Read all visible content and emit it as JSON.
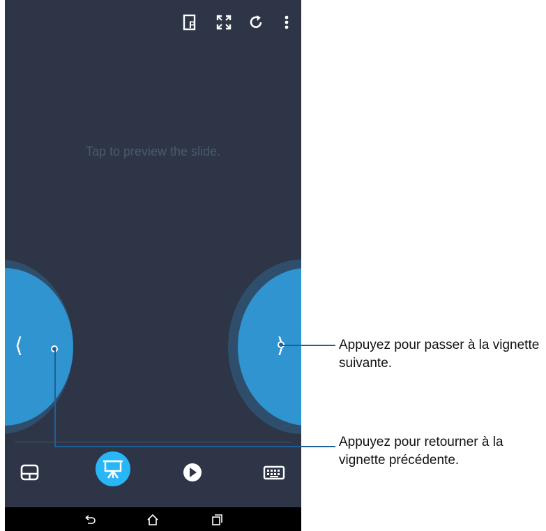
{
  "preview": {
    "hint": "Tap to preview the slide."
  },
  "nav": {
    "prev_glyph": "⟨",
    "next_glyph": "⟩"
  },
  "topbar": {
    "icons": [
      "present-icon",
      "fullscreen-icon",
      "refresh-icon",
      "more-icon"
    ]
  },
  "toolbar": {
    "icons": [
      "touchpad-icon",
      "presentation-icon",
      "play-icon",
      "keyboard-icon"
    ],
    "active": "presentation-icon"
  },
  "system_nav": {
    "icons": [
      "back-icon",
      "home-icon",
      "recents-icon"
    ]
  },
  "callouts": {
    "next_line1": "Appuyez pour passer à la vignette",
    "next_line2": "suivante.",
    "prev_line1": "Appuyez pour retourner à la",
    "prev_line2": "vignette précédente."
  },
  "colors": {
    "screen_bg": "#2d3547",
    "nav_circle": "#2f94d0",
    "nav_ring": "#2f4e6c",
    "active_tool": "#29b6f6",
    "callout_line": "#1f5f99"
  }
}
